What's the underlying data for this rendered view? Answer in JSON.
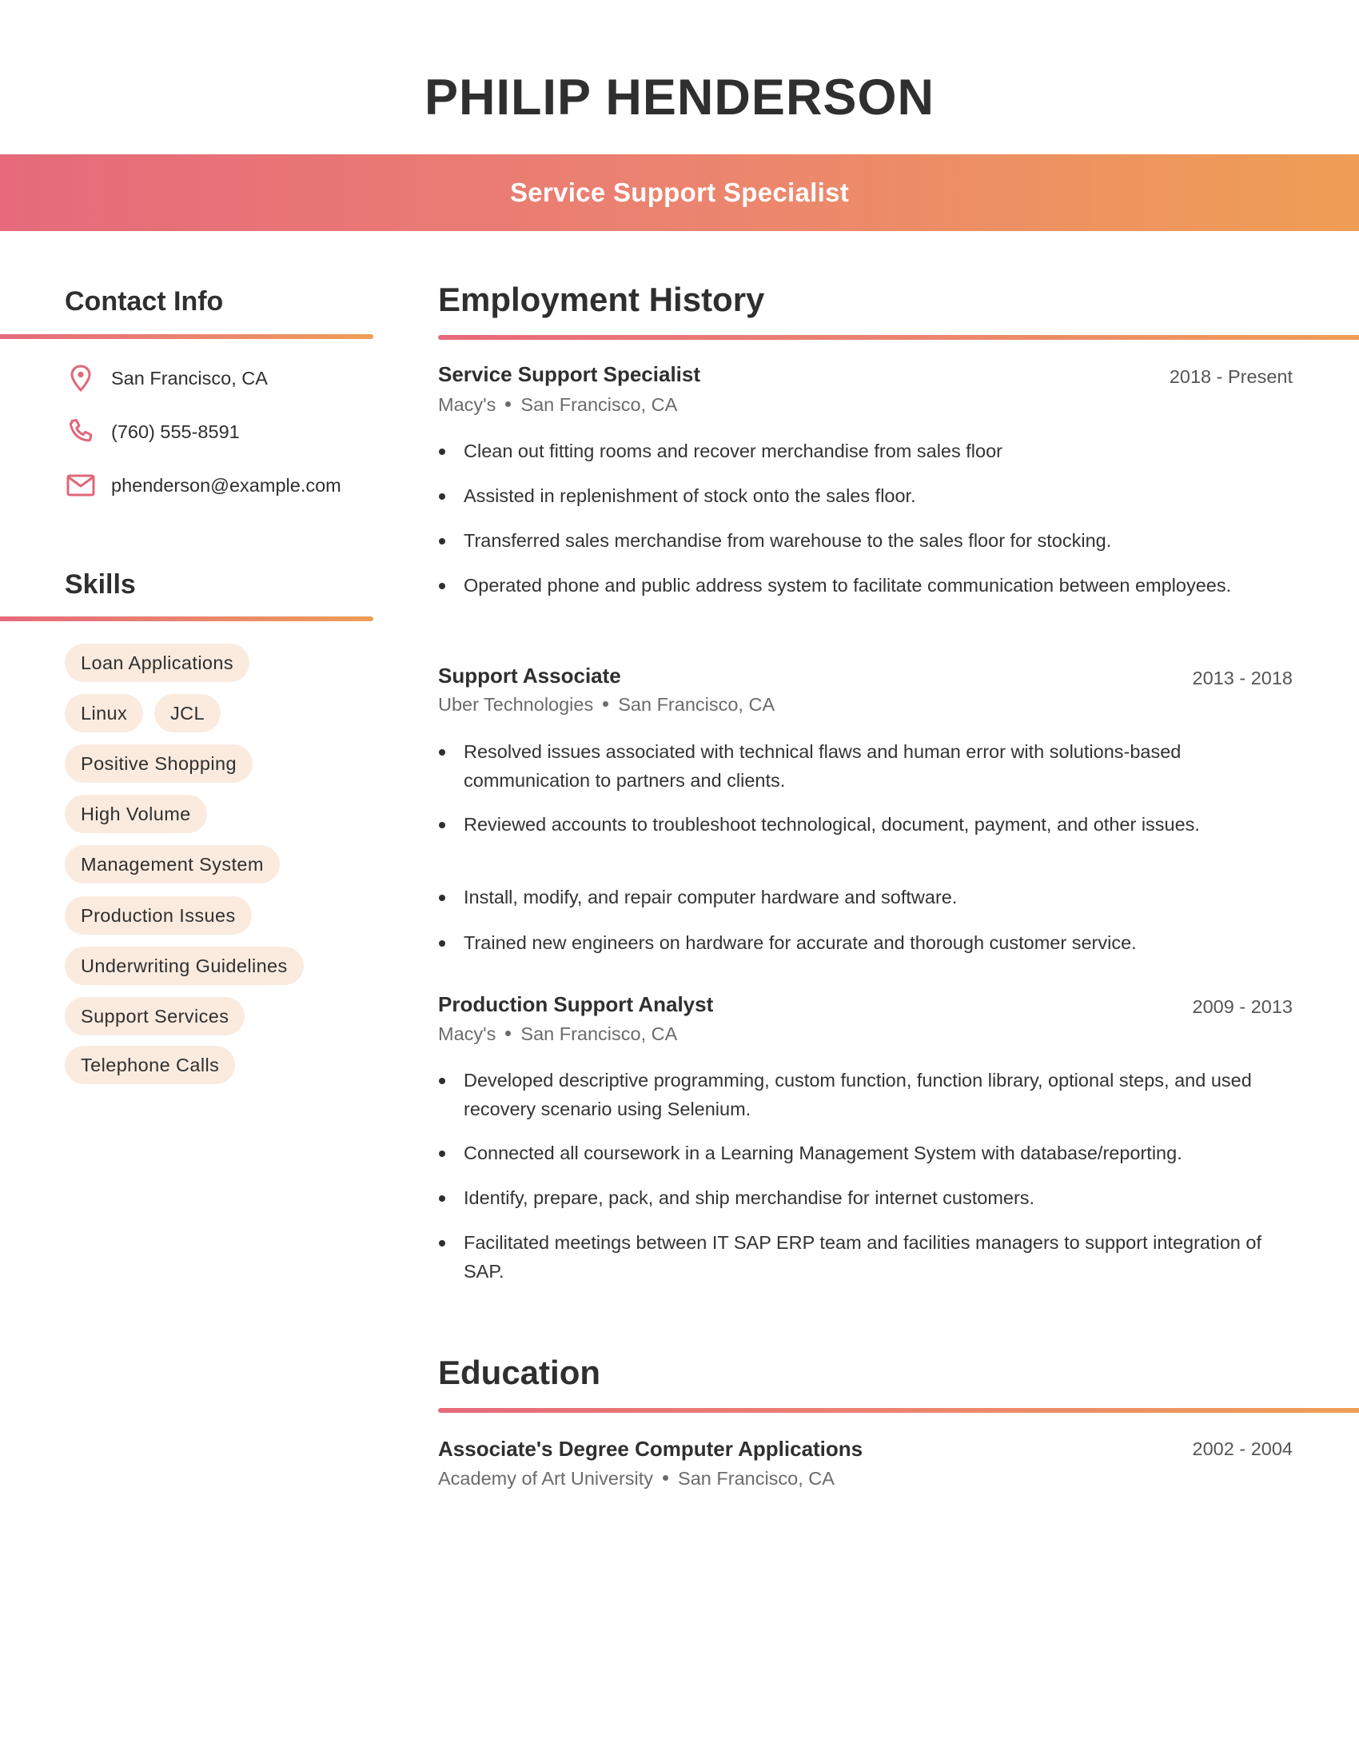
{
  "header": {
    "name": "PHILIP HENDERSON",
    "title": "Service Support Specialist",
    "gradient_colors": [
      "#E66A7B",
      "#EF9E55"
    ]
  },
  "contact": {
    "heading": "Contact Info",
    "items": [
      {
        "icon": "location-pin-icon",
        "text": "San Francisco, CA"
      },
      {
        "icon": "phone-icon",
        "text": "(760) 555-8591"
      },
      {
        "icon": "email-icon",
        "text": "phenderson@example.com"
      }
    ],
    "icon_color": "#E0677A"
  },
  "skills": {
    "heading": "Skills",
    "items": [
      "Loan Applications",
      "Linux",
      "JCL",
      "Positive Shopping",
      "High Volume",
      "Management System",
      "Production Issues",
      "Underwriting Guidelines",
      "Support Services",
      "Telephone Calls"
    ],
    "pill_color": "#FBEBDF"
  },
  "employment": {
    "heading": "Employment History",
    "jobs": [
      {
        "title": "Service Support Specialist",
        "dates": "2018 - Present",
        "company": "Macy's",
        "location": "San Francisco, CA",
        "bullets": [
          "Clean out fitting rooms and recover merchandise from sales floor",
          "Assisted in replenishment of stock onto the sales floor.",
          "Transferred sales merchandise from warehouse to the sales floor for stocking.",
          "Operated phone and public address system to facilitate communication between employees."
        ]
      },
      {
        "title": "Support Associate",
        "dates": "2013 - 2018",
        "company": "Uber Technologies",
        "location": "San Francisco, CA",
        "bullets": [
          "Resolved issues associated with technical flaws and human error with solutions-based communication to partners and clients.",
          "Reviewed accounts to troubleshoot technological, document, payment, and other issues.",
          "Install, modify, and repair computer hardware and software.",
          "Trained new engineers on hardware for accurate and thorough customer service."
        ]
      },
      {
        "title": "Production Support Analyst",
        "dates": "2009 - 2013",
        "company": "Macy's",
        "location": "San Francisco, CA",
        "bullets": [
          "Developed descriptive programming, custom function, function library, optional steps, and used recovery scenario using Selenium.",
          "Connected all coursework in a Learning Management System with database/reporting.",
          "Identify, prepare, pack, and ship merchandise for internet customers.",
          "Facilitated meetings between IT SAP ERP team and facilities managers to support integration of SAP."
        ]
      }
    ]
  },
  "education": {
    "heading": "Education",
    "entries": [
      {
        "degree": "Associate's Degree Computer Applications",
        "dates": "2002 - 2004",
        "school": "Academy of Art University",
        "location": "San Francisco, CA"
      }
    ]
  }
}
